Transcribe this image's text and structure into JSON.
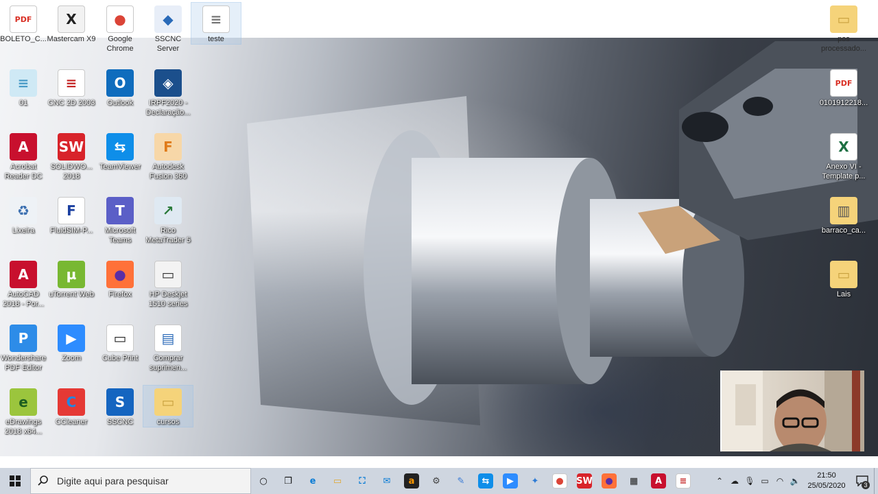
{
  "desktop": {
    "icons_left": [
      {
        "label": "BOLETO_C...",
        "icon": "pdf-icon"
      },
      {
        "label": "Mastercam X9",
        "icon": "mastercam-icon"
      },
      {
        "label": "Google Chrome",
        "icon": "chrome-icon"
      },
      {
        "label": "SSCNC Server",
        "icon": "sscnc-server-icon"
      },
      {
        "label": "teste",
        "icon": "text-file-icon"
      },
      {
        "label": "01",
        "icon": "notepad-icon"
      },
      {
        "label": "CNC 2D 2003",
        "icon": "cnc2d-icon"
      },
      {
        "label": "Outlook",
        "icon": "outlook-icon"
      },
      {
        "label": "IRPF2020 - Declaração...",
        "icon": "irpf-icon"
      },
      {
        "label": "Acrobat Reader DC",
        "icon": "acrobat-icon"
      },
      {
        "label": "SOLIDWO... 2018",
        "icon": "solidworks-icon"
      },
      {
        "label": "TeamViewer",
        "icon": "teamviewer-icon"
      },
      {
        "label": "Autodesk Fusion 360",
        "icon": "fusion360-icon"
      },
      {
        "label": "Lixeira",
        "icon": "recycle-bin-icon"
      },
      {
        "label": "FluidSIM-P...",
        "icon": "fluidsim-icon"
      },
      {
        "label": "Microsoft Teams",
        "icon": "teams-icon"
      },
      {
        "label": "Rico MetaTrader 5",
        "icon": "metatrader-icon"
      },
      {
        "label": "AutoCAD 2018 - Por...",
        "icon": "autocad-icon"
      },
      {
        "label": "uTorrent Web",
        "icon": "utorrent-icon"
      },
      {
        "label": "Firefox",
        "icon": "firefox-icon"
      },
      {
        "label": "HP Deskjet 1510 series",
        "icon": "printer-icon"
      },
      {
        "label": "Wondershare PDF Editor",
        "icon": "wondershare-icon"
      },
      {
        "label": "Zoom",
        "icon": "zoom-icon"
      },
      {
        "label": "Cube Print",
        "icon": "cubeprint-icon"
      },
      {
        "label": "Comprar suprimen...",
        "icon": "supplies-icon"
      },
      {
        "label": "eDrawings 2018 x64...",
        "icon": "edrawings-icon"
      },
      {
        "label": "CCleaner",
        "icon": "ccleaner-icon"
      },
      {
        "label": "SSCNC",
        "icon": "sscnc-icon"
      },
      {
        "label": "cursos",
        "icon": "folder-icon"
      }
    ],
    "icons_right": [
      {
        "label": "pos processado...",
        "icon": "folder-icon"
      },
      {
        "label": "0101912218...",
        "icon": "pdf-icon"
      },
      {
        "label": "Anexo VI - Template p...",
        "icon": "excel-icon"
      },
      {
        "label": "barraco_ca...",
        "icon": "zip-folder-icon"
      },
      {
        "label": "Lais",
        "icon": "folder-icon"
      }
    ]
  },
  "taskbar": {
    "search_placeholder": "Digite aqui para pesquisar",
    "pinned": [
      "cortana-icon",
      "task-view-icon",
      "edge-icon",
      "file-explorer-icon",
      "store-icon",
      "mail-icon",
      "amazon-icon",
      "settings-icon",
      "paint-icon",
      "teamviewer-icon",
      "zoom-icon",
      "bird-icon",
      "chrome-icon",
      "solidworks-icon",
      "firefox-icon",
      "calculator-icon",
      "acrobat-icon",
      "cnc2d-icon"
    ],
    "time": "21:50",
    "date": "25/05/2020",
    "notification_count": "3"
  },
  "colors": {
    "taskbar_bg": "#cfd6e0",
    "accent": "#0078d7"
  }
}
